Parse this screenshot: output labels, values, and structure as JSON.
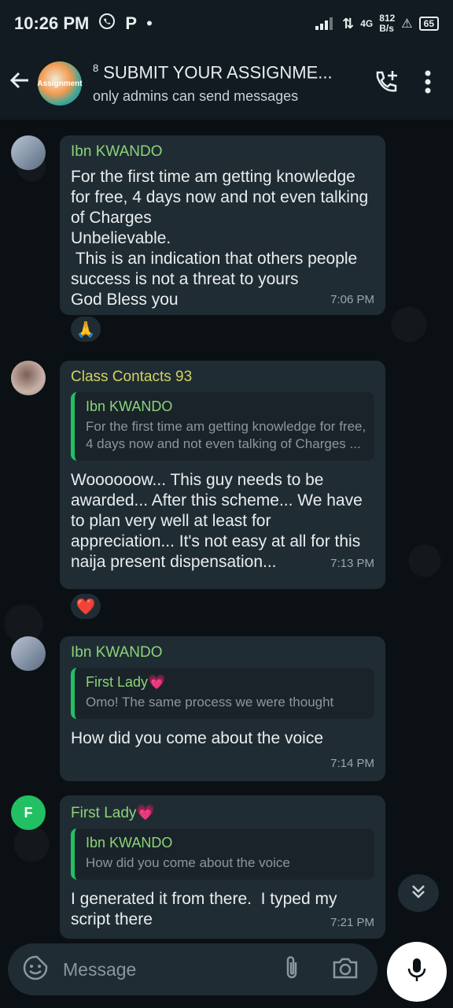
{
  "status_bar": {
    "time": "10:26 PM",
    "net_speed_value": "812",
    "net_speed_unit": "B/s",
    "network_type": "4G",
    "battery": "65"
  },
  "header": {
    "title_count": "8",
    "title": "SUBMIT YOUR ASSIGNME...",
    "subtitle": "only admins can send messages",
    "avatar_text": "Assignment"
  },
  "messages": [
    {
      "sender": "Ibn KWANDO",
      "text": "For the first time am getting knowledge for free, 4 days now and not even talking of Charges\nUnbelievable.\n This is an indication that others people success is not a threat to yours\nGod Bless you",
      "time": "7:06 PM",
      "reaction": "🙏"
    },
    {
      "sender": "Class Contacts 93",
      "quote_author": "Ibn KWANDO",
      "quote_text": "For the first time am getting knowledge for free, 4 days now and not even talking of Charges ...",
      "text": "Woooooow... This guy needs to be awarded... After this scheme... We have to plan very well at least for appreciation... It's not easy at all for this naija present dispensation...",
      "time": "7:13 PM",
      "reaction": "❤️"
    },
    {
      "sender": "Ibn KWANDO",
      "quote_author": "First Lady💗",
      "quote_text": "Omo! The same process we were thought",
      "text": "How did you come about the voice",
      "time": "7:14 PM"
    },
    {
      "sender": "First Lady💗",
      "avatar_letter": "F",
      "quote_author": "Ibn KWANDO",
      "quote_text": "How did you come about the voice",
      "text": "I generated it from there.  I typed my script there",
      "time": "7:21 PM"
    }
  ],
  "input": {
    "placeholder": "Message"
  },
  "colors": {
    "background": "#0b1014",
    "bubble": "#202c33",
    "accent_green": "#21c063"
  }
}
